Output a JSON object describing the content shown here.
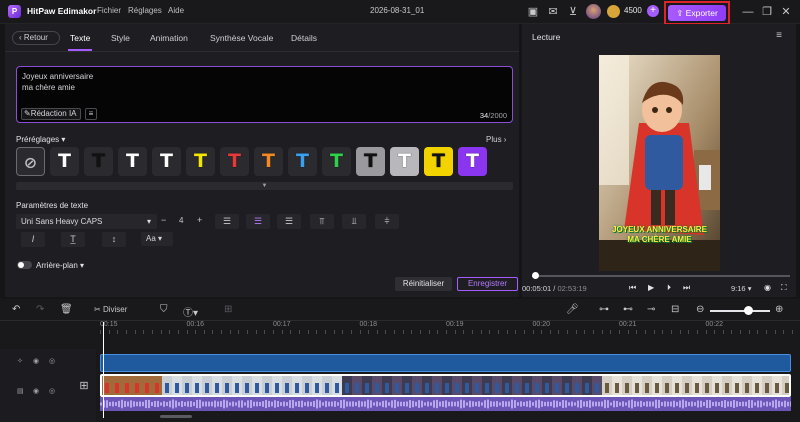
{
  "titlebar": {
    "app_name": "HitPaw Edimakor",
    "menu": [
      "Fichier",
      "Réglages",
      "Aide"
    ],
    "project_name": "2026-08-31_01",
    "credits": "4500",
    "export_label": "Exporter"
  },
  "editor": {
    "back_label": "Retour",
    "tabs": [
      "Texte",
      "Style",
      "Animation",
      "Synthèse Vocale",
      "Détails"
    ],
    "text_content": "Joyeux anniversaire\nma chère amie",
    "ai_label": "Rédaction IA",
    "char_count": "34",
    "char_max": "/2000",
    "presets_label": "Préréglages",
    "more_label": "Plus",
    "presets": [
      {
        "glyph": "T",
        "fg": "#ffffff",
        "bg": "#2a2a2f"
      },
      {
        "glyph": "T",
        "fg": "#111111",
        "bg": "#2a2a2f"
      },
      {
        "glyph": "T",
        "fg": "#ffffff",
        "bg": "#2a2a2f"
      },
      {
        "glyph": "T",
        "fg": "#ffffff",
        "bg": "#2a2a2f"
      },
      {
        "glyph": "T",
        "fg": "#f2e600",
        "bg": "#2a2a2f"
      },
      {
        "glyph": "T",
        "fg": "#e63a3a",
        "bg": "#2a2a2f"
      },
      {
        "glyph": "T",
        "fg": "#f08a24",
        "bg": "#2a2a2f"
      },
      {
        "glyph": "T",
        "fg": "#3aa0f0",
        "bg": "#2a2a2f"
      },
      {
        "glyph": "T",
        "fg": "#2fd04a",
        "bg": "#2a2a2f"
      },
      {
        "glyph": "T",
        "fg": "#111111",
        "bg": "#9a9a9e"
      },
      {
        "glyph": "T",
        "fg": "#ffffff",
        "bg": "#b8b8bc"
      },
      {
        "glyph": "T",
        "fg": "#111111",
        "bg": "#f2d300"
      },
      {
        "glyph": "T",
        "fg": "#ffffff",
        "bg": "#8a35f0"
      }
    ],
    "text_params_label": "Paramètres de texte",
    "font_name": "Uni Sans Heavy CAPS",
    "font_size": "4",
    "case_label": "Aa",
    "background_label": "Arrière-plan",
    "reset_label": "Réinitialiser",
    "save_label": "Enregistrer"
  },
  "preview": {
    "title": "Lecture",
    "caption": "JOYEUX ANNIVERSAIRE\nMA CHÈRE AMIE",
    "current_time": "00:05:01",
    "total_time": "02:53:19",
    "ratio": "9:16",
    "progress": 0.02
  },
  "timeline": {
    "split_label": "Diviser",
    "ruler_labels": [
      "00:15",
      "00:16",
      "00:17",
      "00:18",
      "00:19",
      "00:20",
      "00:21",
      "00:22"
    ],
    "zoom_level": 0.6
  }
}
